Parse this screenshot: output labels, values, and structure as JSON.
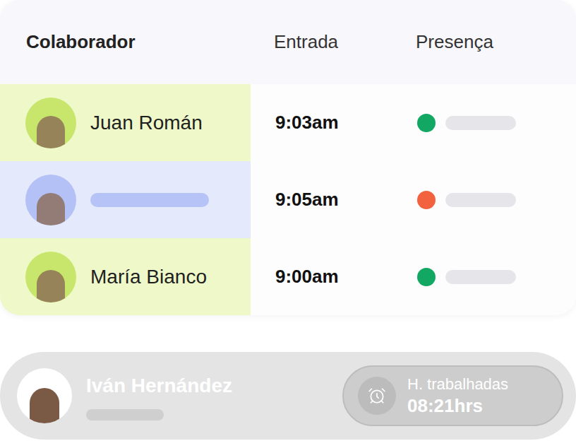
{
  "table": {
    "columns": [
      "Colaborador",
      "Entrada",
      "Presença"
    ],
    "rows": [
      {
        "name": "Juan Román",
        "entry": "9:03am",
        "color": "#eef8c9",
        "avatar_color": "#c7e66b",
        "presence_color": "#12a864"
      },
      {
        "name": null,
        "entry": "9:05am",
        "color": "#e4e9fb",
        "avatar_color": "#b3c1f6",
        "presence_color": "#f2623f"
      },
      {
        "name": "María Bianco",
        "entry": "9:00am",
        "color": "#eef8c9",
        "avatar_color": "#c7e66b",
        "presence_color": "#12a864"
      }
    ]
  },
  "current_user": {
    "name": "Iván Hernández",
    "hours_label": "H. trabalhadas",
    "hours": "08:21hrs"
  }
}
